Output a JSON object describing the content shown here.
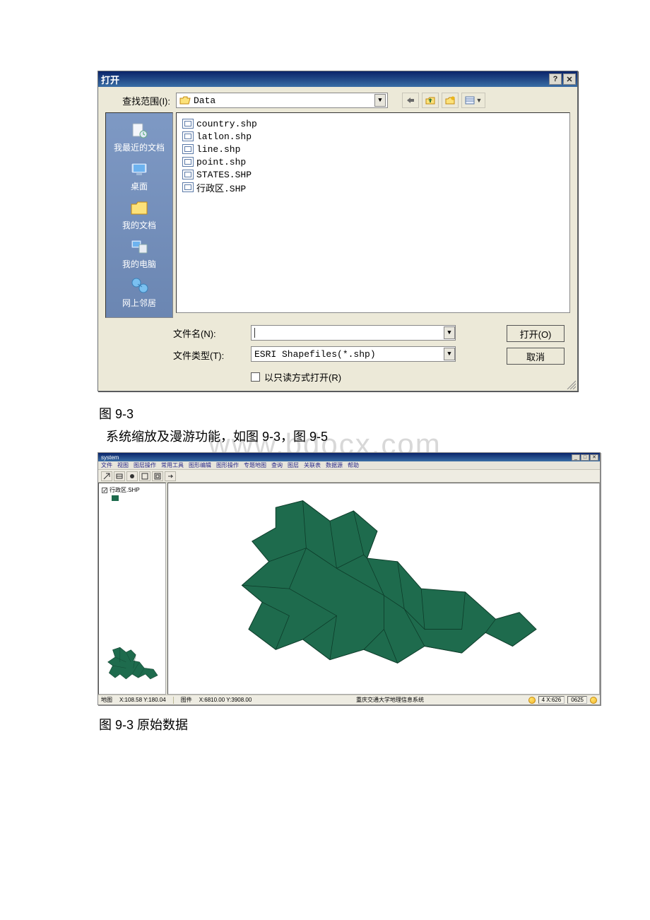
{
  "watermark": "www.bdocx.com",
  "open_dialog": {
    "title": "打开",
    "help_btn": "?",
    "close_btn": "✕",
    "lookin_label": "查找范围(I):",
    "lookin_value": "Data",
    "nav_icons": [
      "back",
      "up",
      "new-folder",
      "views"
    ],
    "places": [
      {
        "label": "我最近的文档",
        "icon": "recent"
      },
      {
        "label": "桌面",
        "icon": "desktop"
      },
      {
        "label": "我的文档",
        "icon": "mydocs"
      },
      {
        "label": "我的电脑",
        "icon": "computer"
      },
      {
        "label": "网上邻居",
        "icon": "network"
      }
    ],
    "files": [
      "country.shp",
      "latlon.shp",
      "line.shp",
      "point.shp",
      "STATES.SHP",
      "行政区.SHP"
    ],
    "filename_label": "文件名(N):",
    "filename_value": "",
    "filetype_label": "文件类型(T):",
    "filetype_value": "ESRI Shapefiles(*.shp)",
    "readonly_label": "以只读方式打开(R)",
    "open_btn": "打开(O)",
    "cancel_btn": "取消"
  },
  "caption1": "图 9-3",
  "description": "系统缩放及漫游功能，如图 9-3，图 9-5",
  "gis_app": {
    "title": "system",
    "win_btns": [
      "_",
      "□",
      "✕"
    ],
    "menus": [
      "文件",
      "视图",
      "图层操作",
      "常用工具",
      "图形编辑",
      "图形操作",
      "专题地图",
      "查询",
      "图层",
      "关联表",
      "数据源",
      "帮助"
    ],
    "layer_name": "行政区.SHP",
    "status_left_label": "地图",
    "status_left_coords": "X:108.58  Y:180.04",
    "status_mid_label": "图件",
    "status_mid_coords": "X:6810.00  Y:3908.00",
    "status_center": "重庆交通大学地理信息系统",
    "status_right_a": "4  X:626",
    "status_right_b": "0625"
  },
  "caption2": "图 9-3 原始数据"
}
